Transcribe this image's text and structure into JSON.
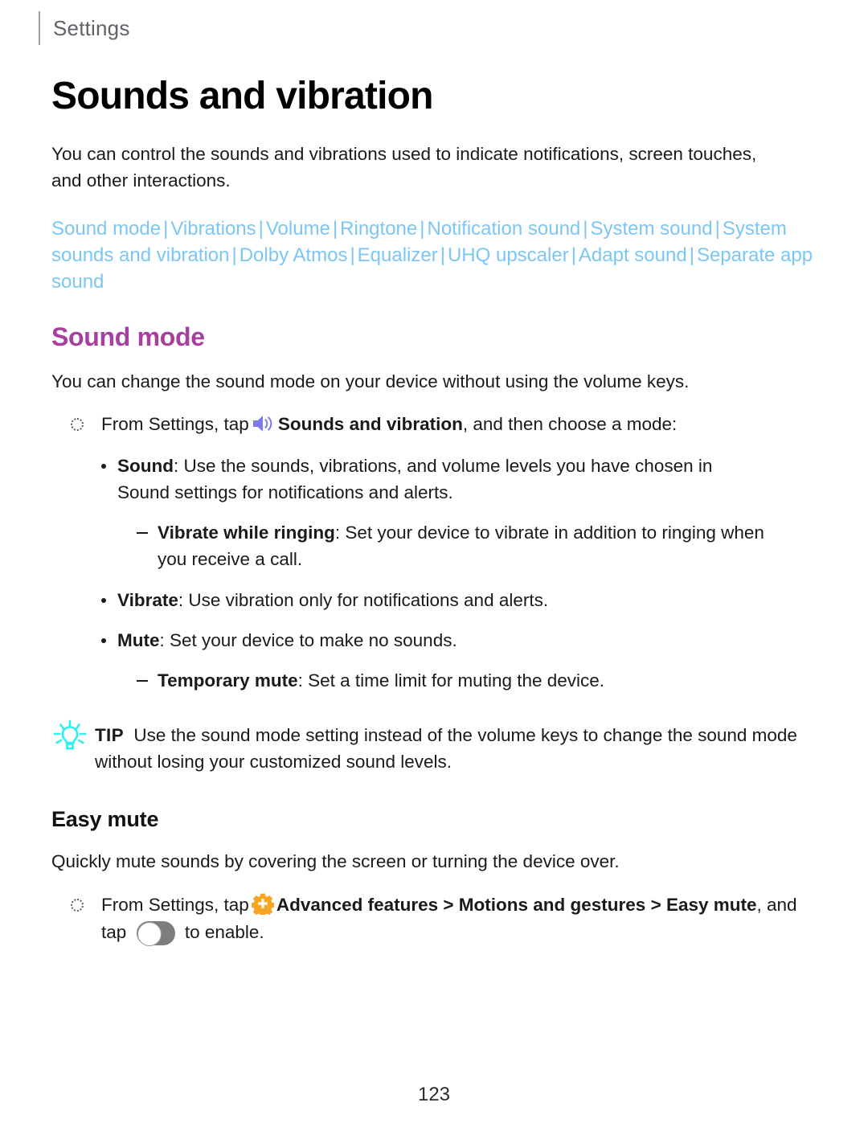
{
  "header": {
    "label": "Settings"
  },
  "title": "Sounds and vibration",
  "intro": "You can control the sounds and vibrations used to indicate notifications, screen touches, and other interactions.",
  "link_bar": {
    "separator": "|",
    "links": [
      "Sound mode",
      "Vibrations",
      "Volume",
      "Ringtone",
      "Notification sound",
      "System sound",
      "System sounds and vibration",
      "Dolby Atmos",
      "Equalizer",
      "UHQ upscaler",
      "Adapt sound",
      "Separate app sound"
    ]
  },
  "sections": [
    {
      "heading": "Sound mode",
      "heading_color": "#a63fa0",
      "intro": "You can change the sound mode on your device without using the volume keys.",
      "step": {
        "before_icon": "From Settings, tap",
        "icon": "speaker-icon",
        "bold_after_icon": "Sounds and vibration",
        "after": ", and then choose a mode:"
      },
      "items": [
        {
          "type": "bullet",
          "bold": "Sound",
          "rest": ": Use the sounds, vibrations, and volume levels you have chosen in Sound settings for notifications and alerts."
        },
        {
          "type": "dash",
          "bold": "Vibrate while ringing",
          "rest": ": Set your device to vibrate in addition to ringing when you receive a call."
        },
        {
          "type": "bullet",
          "bold": "Vibrate",
          "rest": ": Use vibration only for notifications and alerts."
        },
        {
          "type": "bullet",
          "bold": "Mute",
          "rest": ": Set your device to make no sounds."
        },
        {
          "type": "dash",
          "bold": "Temporary mute",
          "rest": ": Set a time limit for muting the device."
        }
      ],
      "tip": {
        "icon": "lightbulb-icon",
        "icon_color": "#2ff0f0",
        "label": "TIP",
        "text": "Use the sound mode setting instead of the volume keys to change the sound mode without losing your customized sound levels."
      }
    },
    {
      "heading": "Easy mute",
      "heading_color": "#111111",
      "intro": "Quickly mute sounds by covering the screen or turning the device over.",
      "step": {
        "before_icon": "From Settings, tap",
        "icon": "gear-icon",
        "bold_after_icon": "Advanced features > Motions and gestures > Easy mute",
        "after": ", and tap",
        "toggle": "toggle-switch-off",
        "tail": "to enable."
      }
    }
  ],
  "colors": {
    "link": "#7cc6f5",
    "heading_purple": "#a63fa0",
    "speaker_icon": "#7b7bea",
    "gear_icon": "#f5a623",
    "tip_icon": "#2ff0f0",
    "toggle_track": "#7d7d7d"
  },
  "page_number": "123"
}
